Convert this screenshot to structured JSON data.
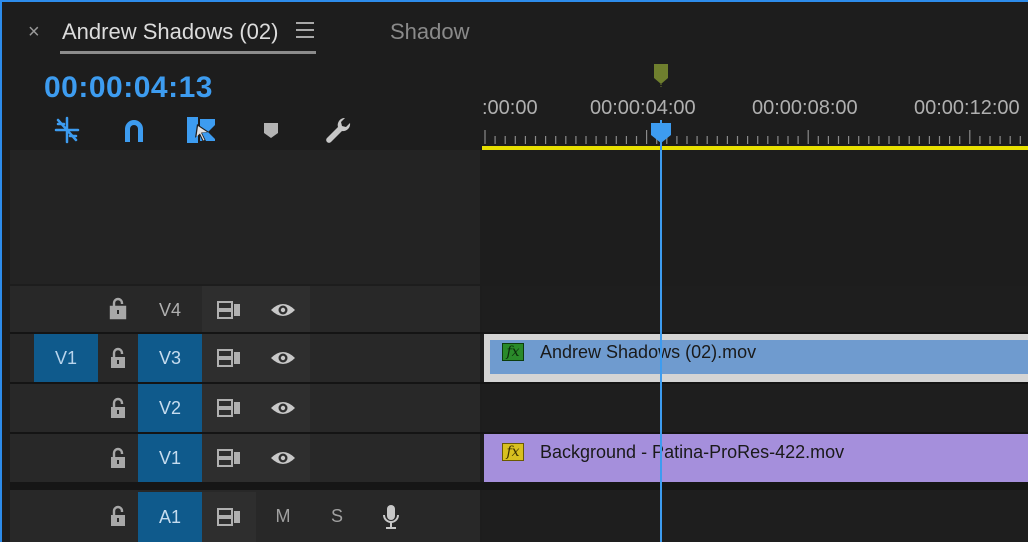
{
  "header": {
    "close_glyph": "×",
    "sequence_tab": "Andrew Shadows (02)",
    "second_tab": "Shadow",
    "timecode": "00:00:04:13"
  },
  "toolbar": {
    "tools": [
      "insert-overwrite-icon",
      "snap-magnet-icon",
      "linked-selection-icon",
      "add-marker-icon",
      "timeline-settings-wrench-icon"
    ],
    "accent": "#3d9cf0"
  },
  "ruler": {
    "labels": [
      ":00:00",
      "00:00:04:00",
      "00:00:08:00",
      "00:00:12:00"
    ]
  },
  "tracks": [
    {
      "name": "V4",
      "targeted": false,
      "source_patch": ""
    },
    {
      "name": "V3",
      "targeted": true,
      "source_patch": "V1"
    },
    {
      "name": "V2",
      "targeted": true,
      "source_patch": ""
    },
    {
      "name": "V1",
      "targeted": true,
      "source_patch": ""
    },
    {
      "name": "A1",
      "targeted": true,
      "source_patch": "",
      "mute": "M",
      "solo": "S"
    }
  ],
  "clips": {
    "v3": {
      "fx": "fx",
      "label": "Andrew Shadows (02).mov",
      "color": "#6f9bcf"
    },
    "v1": {
      "fx": "fx",
      "label": "Background - Patina-ProRes-422.mov",
      "color": "#a58fdc"
    }
  },
  "colors": {
    "work_area_bar": "#e8e000",
    "target_blue": "#0f5a8c",
    "marker_green": "#6f7f2e"
  }
}
